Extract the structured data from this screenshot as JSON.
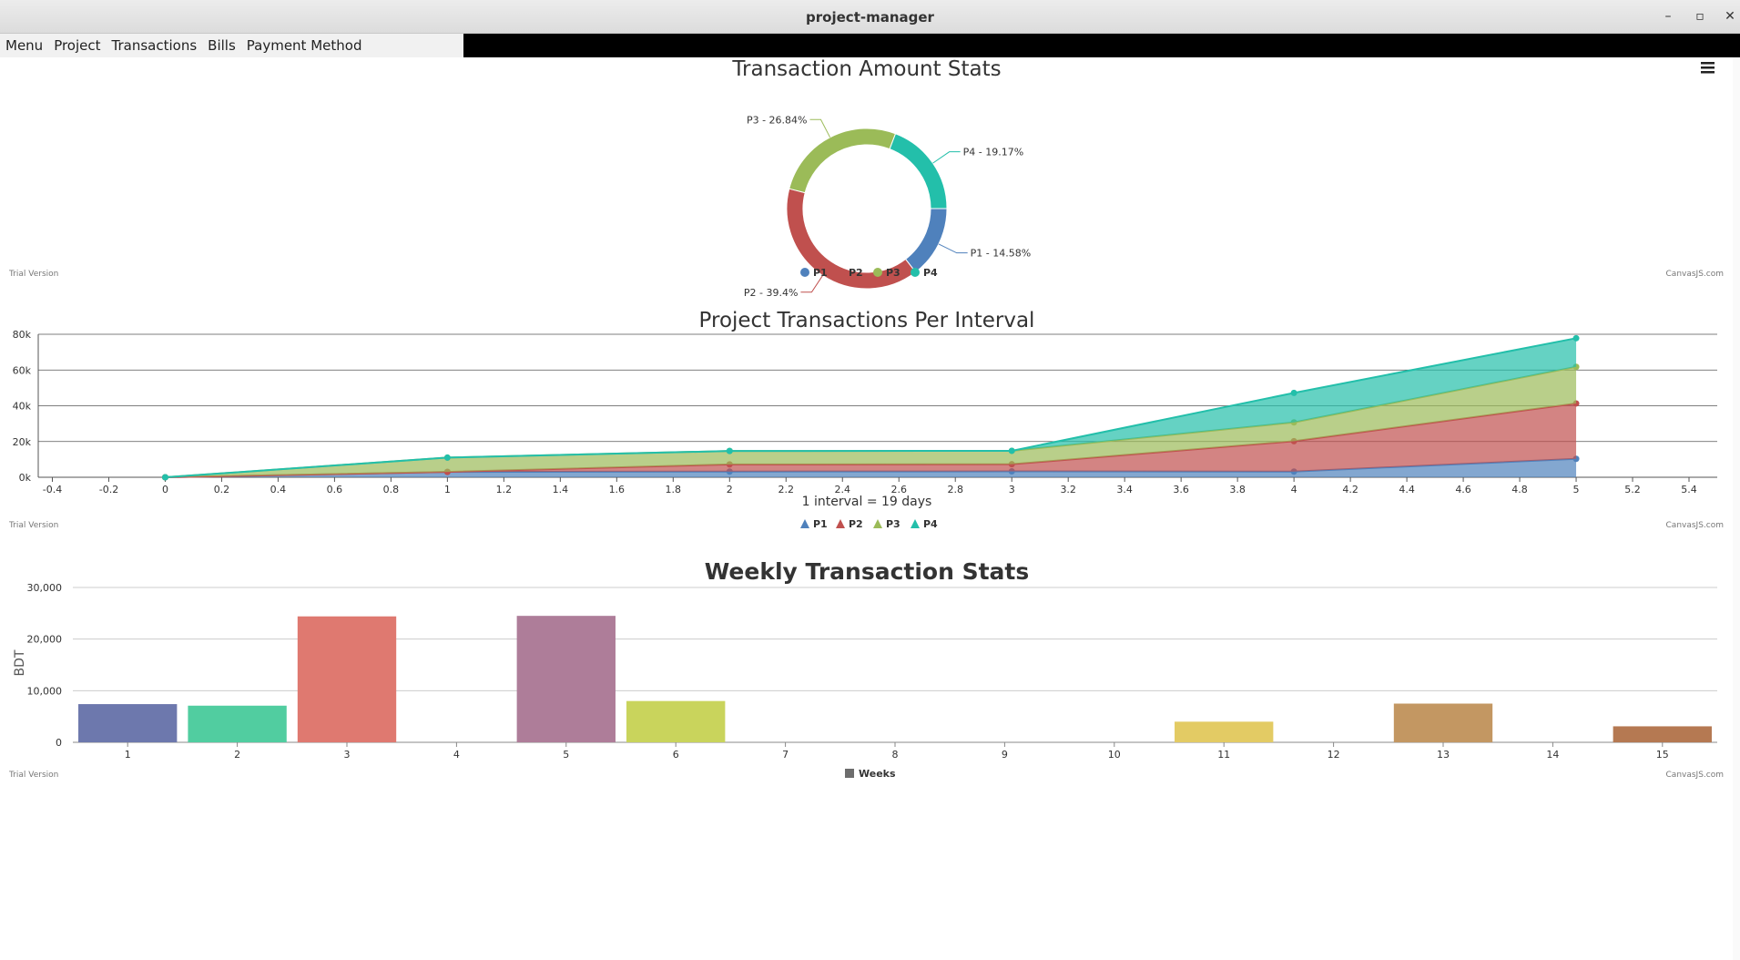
{
  "window": {
    "title": "project-manager",
    "minimize": "–",
    "maximize": "▫",
    "close": "✕"
  },
  "menubar": {
    "items": [
      "Menu",
      "Project",
      "Transactions",
      "Bills",
      "Payment Method"
    ]
  },
  "watermarks": {
    "trial": "Trial Version",
    "credit": "CanvasJS.com"
  },
  "export_menu_icon": "hamburger-icon",
  "chart_data": [
    {
      "type": "pie",
      "title": "Transaction Amount Stats",
      "labels": [
        "P1",
        "P2",
        "P3",
        "P4"
      ],
      "values": [
        14.58,
        39.4,
        26.84,
        19.17
      ],
      "slice_labels": [
        "P1 - 14.58%",
        "P2 - 39.4%",
        "P3 - 26.84%",
        "P4 - 19.17%"
      ],
      "colors": [
        "#4f81bc",
        "#c0504e",
        "#9bbb58",
        "#23bfaa"
      ],
      "legend": [
        "P1",
        "P2",
        "P3",
        "P4"
      ],
      "legend_placement": "bottom-center"
    },
    {
      "type": "area",
      "title": "Project Transactions Per Interval",
      "xlabel": "1 interval = 19 days",
      "ylabel": "",
      "x": [
        0,
        1,
        2,
        3,
        4,
        5
      ],
      "xlim": [
        -0.45,
        5.5
      ],
      "xticks": [
        "-0.4",
        "-0.2",
        "0",
        "0.2",
        "0.4",
        "0.6",
        "0.8",
        "1",
        "1.2",
        "1.4",
        "1.6",
        "1.8",
        "2",
        "2.2",
        "2.4",
        "2.6",
        "2.8",
        "3",
        "3.2",
        "3.4",
        "3.6",
        "3.8",
        "4",
        "4.2",
        "4.4",
        "4.6",
        "4.8",
        "5",
        "5.2",
        "5.4"
      ],
      "ylim": [
        0,
        80000
      ],
      "yticks": [
        "0k",
        "20k",
        "40k",
        "60k",
        "80k"
      ],
      "grid": true,
      "stacked": true,
      "series": [
        {
          "name": "P1",
          "values": [
            0,
            3000,
            3200,
            3300,
            3200,
            10300
          ],
          "color": "#4f81bc"
        },
        {
          "name": "P2",
          "values": [
            0,
            0,
            4000,
            4000,
            17000,
            31000
          ],
          "color": "#c0504e"
        },
        {
          "name": "P3",
          "values": [
            0,
            8000,
            7500,
            7500,
            10500,
            20500
          ],
          "color": "#9bbb58"
        },
        {
          "name": "P4",
          "values": [
            0,
            0,
            0,
            0,
            16500,
            16000
          ],
          "color": "#23bfaa"
        }
      ],
      "legend": [
        "P1",
        "P2",
        "P3",
        "P4"
      ],
      "legend_placement": "bottom-center"
    },
    {
      "type": "bar",
      "title": "Weekly Transaction Stats",
      "ylabel": "BDT",
      "xlabel": "",
      "categories": [
        "1",
        "2",
        "3",
        "4",
        "5",
        "6",
        "7",
        "8",
        "9",
        "10",
        "11",
        "12",
        "13",
        "14",
        "15"
      ],
      "values": [
        7400,
        7100,
        24400,
        0,
        24500,
        8000,
        0,
        0,
        0,
        0,
        4000,
        0,
        7500,
        0,
        3100
      ],
      "colors": [
        "#6d78ad",
        "#51cda0",
        "#df7970",
        "#4c9ca0",
        "#ae7d99",
        "#c9d45c",
        "#5592ad",
        "#df874d",
        "#52bca8",
        "#8e7fa5",
        "#e3cb64",
        "#c77b85",
        "#c39762",
        "#8dd17e",
        "#b57952"
      ],
      "ylim": [
        0,
        30000
      ],
      "yticks": [
        "0",
        "10,000",
        "20,000",
        "30,000"
      ],
      "grid": true,
      "legend": [
        "Weeks"
      ],
      "legend_color": "#6d6d6d",
      "legend_placement": "bottom-center"
    }
  ]
}
